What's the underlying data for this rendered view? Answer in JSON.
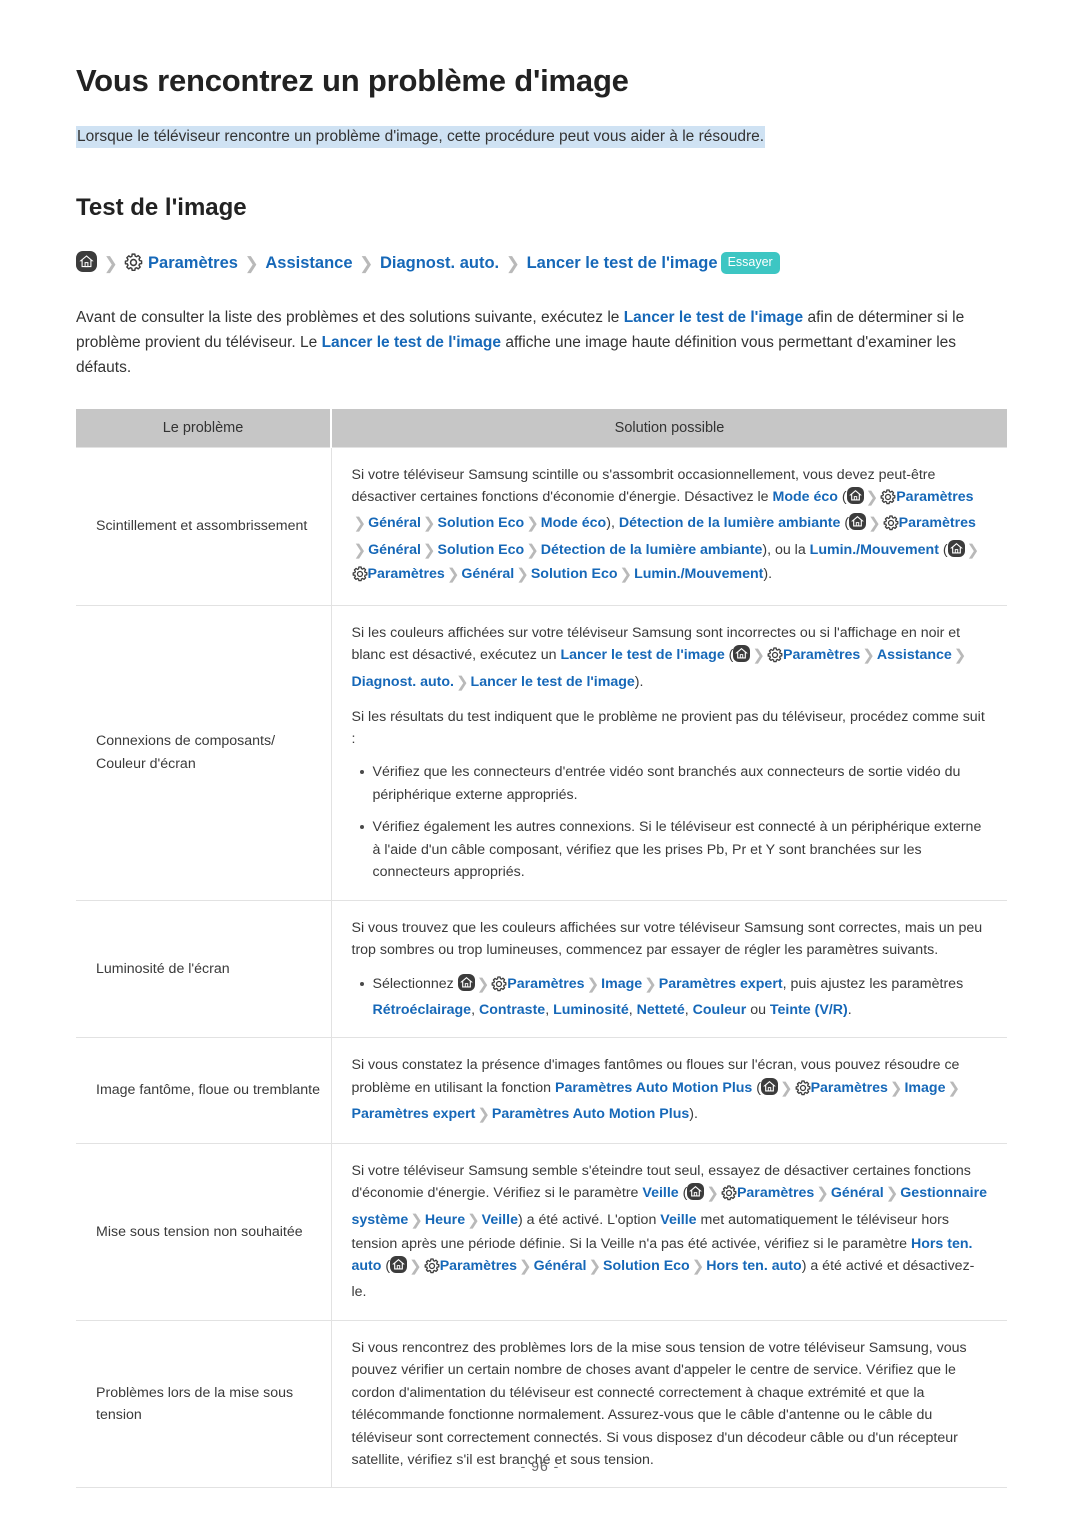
{
  "document": {
    "title": "Vous rencontrez un problème d'image",
    "intro_highlight": "Lorsque le téléviseur rencontre un problème d'image, cette procédure peut vous aider à le résoudre.",
    "section_title": "Test de l'image",
    "page_number": "- 96 -"
  },
  "colors": {
    "link": "#1668b8",
    "highlight": "#cfe2f3",
    "badge": "#3dc6c3",
    "table_header": "#c6c6c6",
    "icon_dark": "#3c3c3c"
  },
  "breadcrumb": {
    "home_icon": "home-icon",
    "gear_icon": "gear-icon",
    "separator": "chevron-right-icon",
    "items": [
      "Paramètres",
      "Assistance",
      "Diagnost. auto.",
      "Lancer le test de l'image"
    ],
    "badge": "Essayer"
  },
  "intro_paragraph": {
    "part1": "Avant de consulter la liste des problèmes et des solutions suivante, exécutez le ",
    "link1": "Lancer le test de l'image",
    "part2": " afin de déterminer si le problème provient du téléviseur. Le ",
    "link2": "Lancer le test de l'image",
    "part3": " affiche une image haute définition vous permettant d'examiner les défauts."
  },
  "table": {
    "headers": {
      "problem": "Le problème",
      "solution": "Solution possible"
    },
    "rows": [
      {
        "problem": "Scintillement et assombrissement",
        "solution": {
          "t1": "Si votre téléviseur Samsung scintille ou s'assombrit occasionnellement, vous devez peut-être désactiver certaines fonctions d'économie d'énergie. Désactivez le ",
          "l1": "Mode éco",
          "t2": " (",
          "p1": "Paramètres",
          "p2": "Général",
          "p3": "Solution Eco",
          "p4": "Mode éco",
          "t3": "), ",
          "l2": "Détection de la lumière ambiante",
          "t4": " (",
          "p5": "Paramètres",
          "p6": "Général",
          "p7": "Solution Eco",
          "p8": "Détection de la lumière ambiante",
          "t5": "), ou la ",
          "l3": "Lumin./Mouvement",
          "t6": " (",
          "p9": "Paramètres",
          "p10": "Général",
          "p11": "Solution Eco",
          "p12": "Lumin./Mouvement",
          "t7": ")."
        }
      },
      {
        "problem": "Connexions de composants/ Couleur d'écran",
        "solution": {
          "t1": "Si les couleurs affichées sur votre téléviseur Samsung sont incorrectes ou si l'affichage en noir et blanc est désactivé, exécutez un ",
          "l1": "Lancer le test de l'image",
          "t2": " (",
          "p1": "Paramètres",
          "p2": "Assistance",
          "p3": "Diagnost. auto.",
          "p4": "Lancer le test de l'image",
          "t3": ").",
          "t4": "Si les résultats du test indiquent que le problème ne provient pas du téléviseur, procédez comme suit :",
          "bullets": [
            "Vérifiez que les connecteurs d'entrée vidéo sont branchés aux connecteurs de sortie vidéo du périphérique externe appropriés.",
            "Vérifiez également les autres connexions. Si le téléviseur est connecté à un périphérique externe à l'aide d'un câble composant, vérifiez que les prises Pb, Pr et Y sont branchées sur les connecteurs appropriés."
          ]
        }
      },
      {
        "problem": "Luminosité de l'écran",
        "solution": {
          "t1": "Si vous trouvez que les couleurs affichées sur votre téléviseur Samsung sont correctes, mais un peu trop sombres ou trop lumineuses, commencez par essayer de régler les paramètres suivants.",
          "b1_pre": "Sélectionnez ",
          "p1": "Paramètres",
          "p2": "Image",
          "p3": "Paramètres expert",
          "b1_mid": ", puis ajustez les paramètres ",
          "s1": "Rétroéclairage",
          "s2": "Contraste",
          "s3": "Luminosité",
          "s4": "Netteté",
          "s5": "Couleur",
          "b1_or": " ou ",
          "s6": "Teinte (V/R)",
          "b1_end": "."
        }
      },
      {
        "problem": "Image fantôme, floue ou tremblante",
        "solution": {
          "t1": "Si vous constatez la présence d'images fantômes ou floues sur l'écran, vous pouvez résoudre ce problème en utilisant la fonction ",
          "l1": "Paramètres Auto Motion Plus",
          "t2": " (",
          "p1": "Paramètres",
          "p2": "Image",
          "p3": "Paramètres expert",
          "p4": "Paramètres Auto Motion Plus",
          "t3": ")."
        }
      },
      {
        "problem": "Mise sous tension non souhaitée",
        "solution": {
          "t1": "Si votre téléviseur Samsung semble s'éteindre tout seul, essayez de désactiver certaines fonctions d'économie d'énergie. Vérifiez si le paramètre ",
          "l1": "Veille",
          "t2": " (",
          "p1": "Paramètres",
          "p2": "Général",
          "p3": "Gestionnaire système",
          "p4": "Heure",
          "p5": "Veille",
          "t3": ") a été activé. L'option ",
          "l2": "Veille",
          "t4": " met automatiquement le téléviseur hors tension après une période définie. Si la Veille n'a pas été activée, vérifiez si le paramètre ",
          "l3": "Hors ten. auto",
          "t5": " (",
          "p6": "Paramètres",
          "p7": "Général",
          "p8": "Solution Eco",
          "p9": "Hors ten. auto",
          "t6": ") a été activé et désactivez-le."
        }
      },
      {
        "problem": "Problèmes lors de la mise sous tension",
        "solution": {
          "t1": "Si vous rencontrez des problèmes lors de la mise sous tension de votre téléviseur Samsung, vous pouvez vérifier un certain nombre de choses avant d'appeler le centre de service. Vérifiez que le cordon d'alimentation du téléviseur est connecté correctement à chaque extrémité et que la télécommande fonctionne normalement. Assurez-vous que le câble d'antenne ou le câble du téléviseur sont correctement connectés. Si vous disposez d'un décodeur câble ou d'un récepteur satellite, vérifiez s'il est branché et sous tension."
        }
      }
    ]
  }
}
